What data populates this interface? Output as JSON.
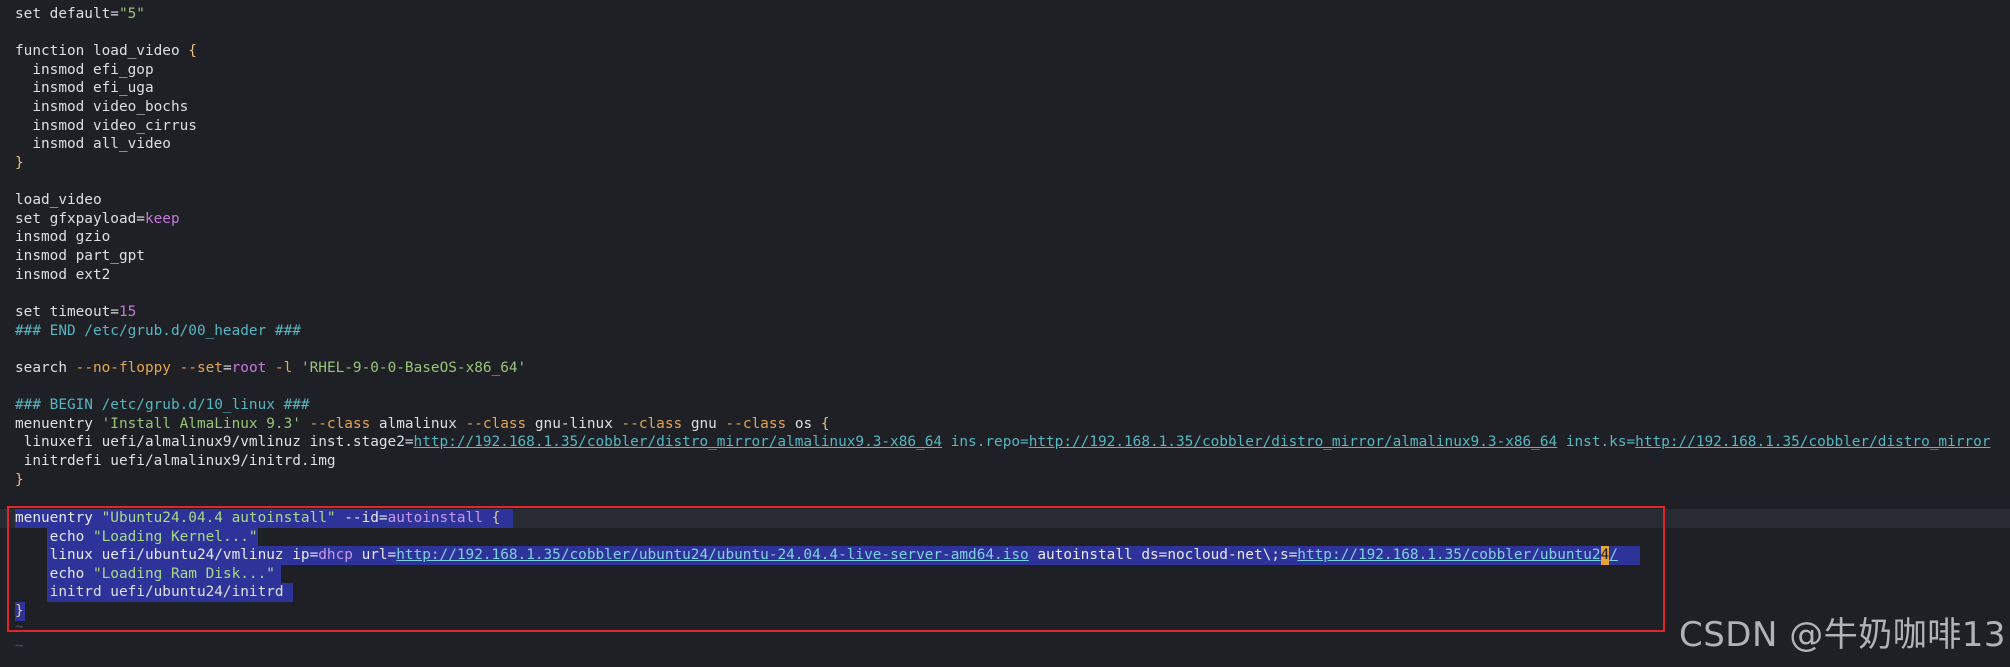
{
  "editor": {
    "lines": [
      "set default=\"5\"",
      "",
      "function load_video {",
      "  insmod efi_gop",
      "  insmod efi_uga",
      "  insmod video_bochs",
      "  insmod video_cirrus",
      "  insmod all_video",
      "}",
      "",
      "load_video",
      "set gfxpayload=keep",
      "insmod gzio",
      "insmod part_gpt",
      "insmod ext2",
      "",
      "set timeout=15",
      "### END /etc/grub.d/00_header ###",
      "",
      "search --no-floppy --set=root -l 'RHEL-9-0-0-BaseOS-x86_64'",
      "",
      "### BEGIN /etc/grub.d/10_linux ###",
      "menuentry 'Install AlmaLinux 9.3' --class almalinux --class gnu-linux --class gnu --class os {",
      " linuxefi uefi/almalinux9/vmlinuz inst.stage2=http://192.168.1.35/cobbler/distro_mirror/almalinux9.3-x86_64 ins.repo=http://192.168.1.35/cobbler/distro_mirror/almalinux9.3-x86_64 inst.ks=http://192.168.1.35/cobbler/distro_mirror",
      " initrdefi uefi/almalinux9/initrd.img",
      "}",
      "",
      "menuentry \"Ubuntu24.04.4 autoinstall\" --id=autoinstall {",
      "    echo \"Loading Kernel...\"",
      "    linux uefi/ubuntu24/vmlinuz ip=dhcp url=http://192.168.1.35/cobbler/ubuntu24/ubuntu-24.04.4-live-server-amd64.iso autoinstall ds=nocloud-net\\;s=http://192.168.1.35/cobbler/ubuntu24/",
      "    echo \"Loading Ram Disk...\"",
      "    initrd uefi/ubuntu24/initrd",
      "}"
    ],
    "tilde_lines": [
      "~",
      "~"
    ],
    "cursor_char": "4"
  },
  "watermark": {
    "text": "CSDN @牛奶咖啡13"
  },
  "colors": {
    "background": "#1f2025",
    "selection": "#2e3399",
    "highlight_box": "#e0262b",
    "cursor": "#e5a13a"
  }
}
